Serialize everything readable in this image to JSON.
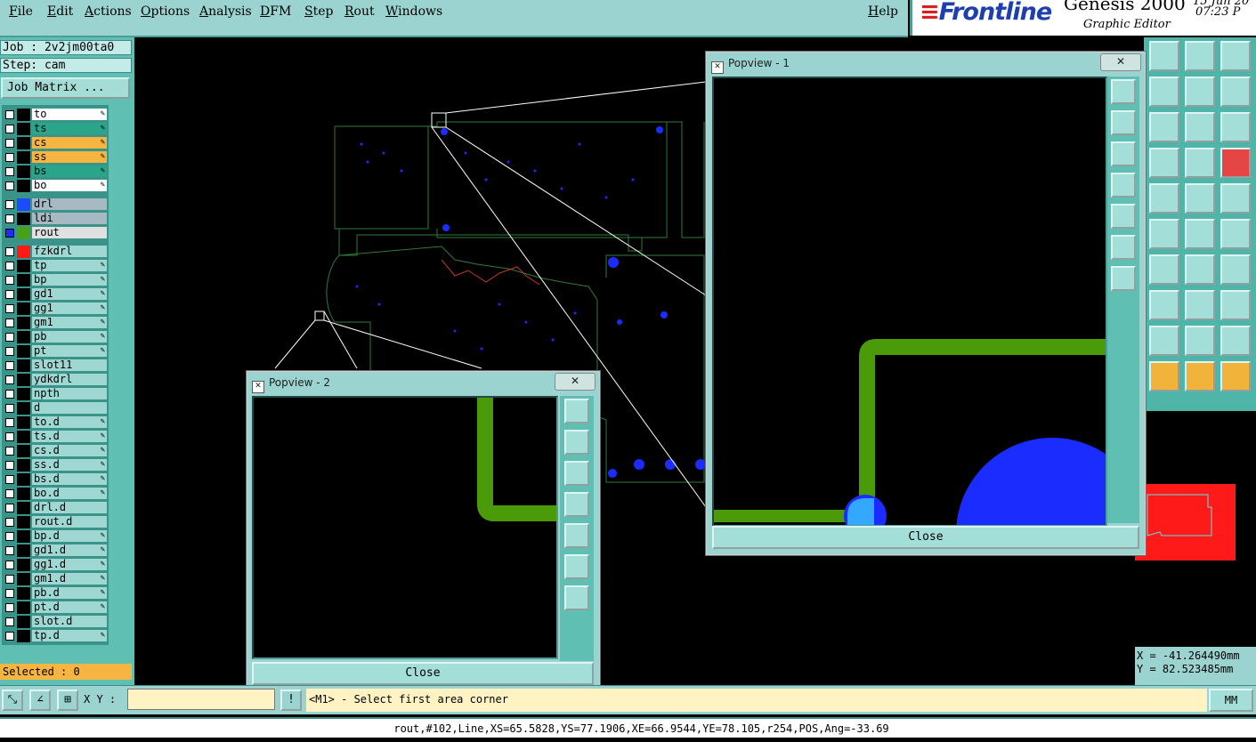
{
  "menu": {
    "items": [
      "File",
      "Edit",
      "Actions",
      "Options",
      "Analysis",
      "DFM",
      "Step",
      "Rout",
      "Windows"
    ],
    "help": "Help"
  },
  "brand": {
    "logo": "Frontline",
    "product": "Genesis 2000",
    "subtitle": "Graphic Editor",
    "date": "15 Jun 20",
    "time": "07:23 P"
  },
  "job": {
    "job_label": "Job : 2v2jm00ta0",
    "step_label": "Step: cam",
    "matrix_button": "Job Matrix ..."
  },
  "layers": [
    {
      "name": "to",
      "color": "#000000",
      "bg": "#ffffff",
      "edit": true
    },
    {
      "name": "ts",
      "color": "#000000",
      "bg": "#2aa58a",
      "edit": true
    },
    {
      "name": "cs",
      "color": "#000000",
      "bg": "#f5b540",
      "edit": true
    },
    {
      "name": "ss",
      "color": "#000000",
      "bg": "#f5b540",
      "edit": true
    },
    {
      "name": "bs",
      "color": "#000000",
      "bg": "#2aa58a",
      "edit": true
    },
    {
      "name": "bo",
      "color": "#000000",
      "bg": "#ffffff",
      "edit": true
    },
    {
      "name": "drl",
      "color": "#1a4bff",
      "bg": "#a7b9c2",
      "edit": false
    },
    {
      "name": "ldi",
      "color": "#000000",
      "bg": "#a7b9c2",
      "edit": false
    },
    {
      "name": "rout",
      "color": "#48a018",
      "bg": "#e0e0e0",
      "edit": false,
      "active": true
    },
    {
      "name": "fzkdrl",
      "color": "#ff1a1a",
      "bg": "#9fd8d3",
      "edit": false
    },
    {
      "name": "tp",
      "color": "#000000",
      "bg": "#9fd8d3",
      "edit": true
    },
    {
      "name": "bp",
      "color": "#000000",
      "bg": "#9fd8d3",
      "edit": true
    },
    {
      "name": "gd1",
      "color": "#000000",
      "bg": "#9fd8d3",
      "edit": true
    },
    {
      "name": "gg1",
      "color": "#000000",
      "bg": "#9fd8d3",
      "edit": true
    },
    {
      "name": "gm1",
      "color": "#000000",
      "bg": "#9fd8d3",
      "edit": true
    },
    {
      "name": "pb",
      "color": "#000000",
      "bg": "#9fd8d3",
      "edit": true
    },
    {
      "name": "pt",
      "color": "#000000",
      "bg": "#9fd8d3",
      "edit": true
    },
    {
      "name": "slot11",
      "color": "#000000",
      "bg": "#9fd8d3",
      "edit": false
    },
    {
      "name": "ydkdrl",
      "color": "#000000",
      "bg": "#9fd8d3",
      "edit": false
    },
    {
      "name": "npth",
      "color": "#000000",
      "bg": "#9fd8d3",
      "edit": false
    },
    {
      "name": "d",
      "color": "#000000",
      "bg": "#9fd8d3",
      "edit": false
    },
    {
      "name": "to.d",
      "color": "#000000",
      "bg": "#9fd8d3",
      "edit": true
    },
    {
      "name": "ts.d",
      "color": "#000000",
      "bg": "#9fd8d3",
      "edit": true
    },
    {
      "name": "cs.d",
      "color": "#000000",
      "bg": "#9fd8d3",
      "edit": true
    },
    {
      "name": "ss.d",
      "color": "#000000",
      "bg": "#9fd8d3",
      "edit": true
    },
    {
      "name": "bs.d",
      "color": "#000000",
      "bg": "#9fd8d3",
      "edit": true
    },
    {
      "name": "bo.d",
      "color": "#000000",
      "bg": "#9fd8d3",
      "edit": true
    },
    {
      "name": "drl.d",
      "color": "#000000",
      "bg": "#9fd8d3",
      "edit": false
    },
    {
      "name": "rout.d",
      "color": "#000000",
      "bg": "#9fd8d3",
      "edit": false
    },
    {
      "name": "bp.d",
      "color": "#000000",
      "bg": "#9fd8d3",
      "edit": true
    },
    {
      "name": "gd1.d",
      "color": "#000000",
      "bg": "#9fd8d3",
      "edit": true
    },
    {
      "name": "gg1.d",
      "color": "#000000",
      "bg": "#9fd8d3",
      "edit": true
    },
    {
      "name": "gm1.d",
      "color": "#000000",
      "bg": "#9fd8d3",
      "edit": true
    },
    {
      "name": "pb.d",
      "color": "#000000",
      "bg": "#9fd8d3",
      "edit": true
    },
    {
      "name": "pt.d",
      "color": "#000000",
      "bg": "#9fd8d3",
      "edit": true
    },
    {
      "name": "slot.d",
      "color": "#000000",
      "bg": "#9fd8d3",
      "edit": false
    },
    {
      "name": "tp.d",
      "color": "#000000",
      "bg": "#9fd8d3",
      "edit": true
    }
  ],
  "selected": "Selected : 0",
  "popview1": {
    "title": "Popview - 1",
    "close": "Close"
  },
  "popview2": {
    "title": "Popview - 2",
    "close": "Close"
  },
  "coords": {
    "x": "X = -41.264490mm",
    "y": "Y = 82.523485mm"
  },
  "command": {
    "xy_label": "X Y :",
    "xy_value": "",
    "prompt": "<M1> - Select first area corner",
    "units": "MM"
  },
  "status": "rout,#102,Line,XS=65.5828,YS=77.1906,XE=66.9544,YE=78.105,r254,POS,Ang=-33.69",
  "colors": {
    "rout": "#4a9a0a",
    "drill": "#1a2cff",
    "outline": "#2f7a3a",
    "drill_light": "#34a7ff"
  }
}
